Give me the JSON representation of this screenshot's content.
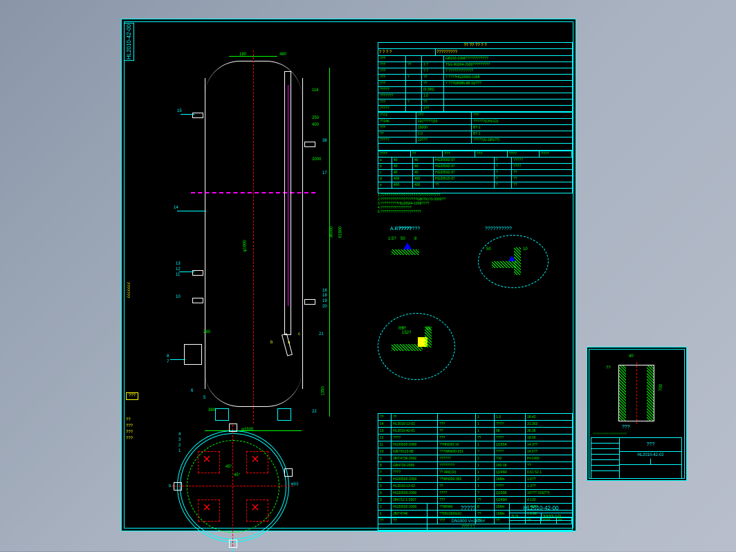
{
  "drawing_id": "HL2010-42-00",
  "main": {
    "title_top": "?? ?? ?? ? ?",
    "spec_header_left": "? ? ? ?",
    "spec_header_right": "?????????",
    "specs": [
      {
        "k1": "???",
        "k2": "",
        "k3": "",
        "v": "GB150-1998????????????"
      },
      {
        "k1": "???",
        "k2": "??",
        "k3": "3 ?",
        "v": "TSG R0004-2009?????????"
      },
      {
        "k1": "???",
        "k2": "",
        "k3": "? ?",
        "v": "? ?????????????"
      },
      {
        "k1": "???",
        "k2": "?",
        "k3": "??",
        "v": "? ????HG20583-1998"
      },
      {
        "k1": "???",
        "k2": "",
        "k3": "??",
        "v": "? ???GB985-88 15/???"
      },
      {
        "k1": "?????",
        "k2": "",
        "k3": "(0.395)",
        "v": ""
      },
      {
        "k1": "???????",
        "k2": "",
        "k3": "1.0",
        "v": ""
      },
      {
        "k1": "???",
        "k2": "?",
        "k3": "??",
        "v": ""
      },
      {
        "k1": "?????",
        "k2": "",
        "k3": "3??",
        "v": ""
      },
      {
        "k1": "???",
        "k2": "",
        "k3": "3",
        "v": ""
      },
      {
        "k1": "?????",
        "k2": "",
        "k3": "????",
        "v": ""
      },
      {
        "k1": "",
        "k2": "",
        "k3": "? ????",
        "v": ""
      },
      {
        "k1": "???",
        "k2": "",
        "k3": "1",
        "v": ""
      }
    ],
    "subsec": [
      {
        "a": "??72",
        "b": "???",
        "c": "???"
      },
      {
        "a": "??246",
        "b": "10(?????)20",
        "c": "??????(CHLG)1"
      },
      {
        "a": "???",
        "b": "15000",
        "c": "BT-1"
      },
      {
        "a": "??",
        "b": "1.0",
        "c": "BT-1"
      },
      {
        "a": "?????",
        "b": "10???",
        "c": "?????(G.18%??)"
      }
    ],
    "nozzle_hdr": [
      "????",
      "??",
      "???",
      "???",
      "????",
      "????"
    ],
    "nozzles": [
      {
        "n": "a",
        "s": "40",
        "d": "40",
        "t": "HG20592-97",
        "f": "?",
        "r": "?????"
      },
      {
        "n": "b",
        "s": "40",
        "d": "40",
        "t": "HG20592-97",
        "f": "?",
        "r": "????"
      },
      {
        "n": "c",
        "s": "40",
        "d": "40",
        "t": "HG20592-97",
        "f": "?",
        "r": "??"
      },
      {
        "n": "d",
        "s": "400",
        "d2": "400",
        "t": "HG20615-97",
        "f": "?",
        "r": "??"
      },
      {
        "n": "e",
        "s": "400",
        "d2": "400",
        "t": "??",
        "f": "?",
        "r": "??"
      }
    ],
    "notes": [
      "1.???????????????????????????????",
      "2.???????????????????GB/T6170-2000??",
      "3.?????????HG20584-1998????",
      "4.????????????????",
      "5.?????????????????????"
    ],
    "detail_labels": {
      "A": "A.B?????",
      "B": "??????????",
      "C": "????????"
    },
    "bom": [
      {
        "n": "??",
        "p": "??",
        "d": "",
        "q": "1",
        "m": "1.3",
        "w": "18.42"
      },
      {
        "n": "14",
        "p": "HL2010-12-01",
        "d": "???",
        "q": "1",
        "m": "????",
        "w": "31.302"
      },
      {
        "n": "13",
        "p": "HL2010-42-01",
        "d": "??",
        "q": "1",
        "m": "58",
        "w": "36.35"
      },
      {
        "n": "12",
        "p": "????",
        "d": "???",
        "q": "??",
        "m": "????",
        "w": "18.00"
      },
      {
        "n": "11",
        "p": "HG20592-2009",
        "d": "??HN200-10",
        "q": "1",
        "m": "Q235A",
        "w": "14.3??"
      },
      {
        "n": "10",
        "p": "GB/T9112-88",
        "d": "???WN600-251",
        "q": "?",
        "m": "????",
        "w": "14.5??"
      },
      {
        "n": "9",
        "p": "JB/T4736-2002",
        "d": "??????",
        "q": "2",
        "m": "?10",
        "w": "H=1490"
      },
      {
        "n": "8",
        "p": "GB4730-2005",
        "d": "????????",
        "q": "1",
        "m": "150 18",
        "w": "??"
      },
      {
        "n": "7",
        "p": "????",
        "d": "?? 400(10)",
        "q": "1",
        "m": "Q245R",
        "w": "0.61 52.1"
      },
      {
        "n": "6",
        "p": "HG20592-2009",
        "d": "??WN200-365",
        "q": "2",
        "m": "16Mn",
        "w": "1.6??"
      },
      {
        "n": "5",
        "p": "HL2010-12-02",
        "d": "??",
        "q": "1",
        "m": "????",
        "w": "1.3??"
      },
      {
        "n": "4",
        "p": "HG20593-2009",
        "d": "????",
        "q": "?",
        "m": "Q235B",
        "w": "15??? 316(??)"
      },
      {
        "n": "3",
        "p": "JB4712.1-2007",
        "d": "???",
        "q": "??",
        "m": "Q245R",
        "w": "4 132"
      },
      {
        "n": "2",
        "p": "HG20592-2009",
        "d": "??WN40",
        "q": "8",
        "m": "16Mn",
        "w": "1.46??"
      },
      {
        "n": "1",
        "p": "JB/T4746",
        "d": "??DN1500x10",
        "q": "??",
        "m": "16Mn",
        "w": "1 5.92"
      }
    ],
    "bom_hdr": [
      "??",
      "??",
      "???",
      "??",
      "??",
      "??",
      "????",
      "??"
    ],
    "title_block": {
      "name": "?????",
      "spec_line": "DN1900 V=180m³",
      "dwg": "HL2010-42-00",
      "scale": "? ?",
      "sheet": "???? 1/1",
      "wt": "???? ? ?"
    },
    "side_label": "???????"
  },
  "dims": {
    "d1": "180",
    "d2": "480",
    "d3": "116",
    "d4": "400",
    "d5": "2000",
    "d6": "250",
    "d7": "φ1900",
    "d8": "36000",
    "d9": "φ1500",
    "d10": "61800",
    "d11": "380",
    "d12": "1350",
    "d13": "260"
  },
  "leaders": {
    "l15": "15",
    "l14": "14",
    "l13": "13",
    "l12": "12",
    "l11": "11",
    "l10": "10",
    "l8": "8",
    "l7": "7",
    "l6": "6",
    "l5": "5",
    "l4": "4",
    "l3": "3",
    "l2": "2",
    "l1": "1",
    "l38": "38",
    "l17": "17",
    "l16": "16",
    "l18": "18",
    "l19": "19",
    "l20": "20",
    "l21": "21",
    "l22": "22",
    "la": "a",
    "lb": "b",
    "lc": "c",
    "lg": "g",
    "le": "e(c)"
  },
  "seq": [
    "???",
    "??",
    "???",
    "???",
    "???"
  ],
  "detail_dims": {
    "d1": "1.5?",
    "d2": "50",
    "d3": "8",
    "d4": "50",
    "d5": "R5?",
    "d6": "10",
    "d7": "55",
    "d8": "?152?"
  },
  "aux_sheet": {
    "title": "???",
    "dwg": "HL2010-42-02",
    "note": "??????????????????????",
    "dims": {
      "w": "40",
      "h": "700",
      "t": "??"
    }
  }
}
